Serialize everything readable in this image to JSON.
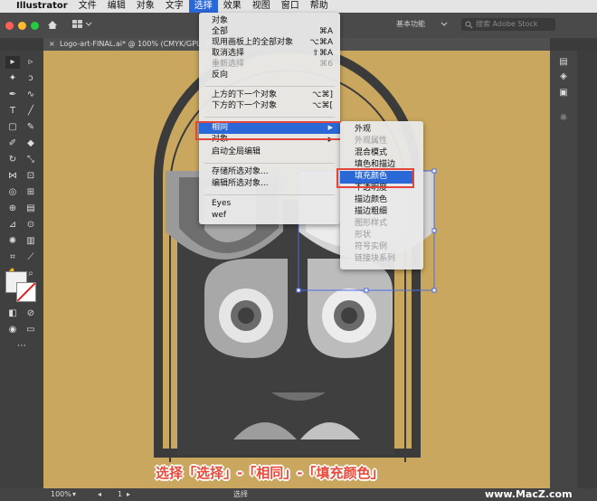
{
  "menubar": {
    "apple": "",
    "app_name": "Illustrator",
    "items": [
      "文件",
      "编辑",
      "对象",
      "文字",
      "选择",
      "效果",
      "视图",
      "窗口",
      "帮助"
    ]
  },
  "appbar": {
    "workspace": "基本功能",
    "search_placeholder": "搜索 Adobe Stock"
  },
  "document_tab": "Logo-art-FINAL.ai* @ 100% (CMYK/GPU 预览)",
  "select_menu": {
    "items": [
      {
        "label": "对象",
        "shortcut": "",
        "disabled": false
      },
      {
        "label": "全部",
        "shortcut": "⌘A",
        "disabled": false
      },
      {
        "label": "现用画板上的全部对象",
        "shortcut": "⌥⌘A",
        "disabled": false
      },
      {
        "label": "取消选择",
        "shortcut": "⇧⌘A",
        "disabled": false
      },
      {
        "label": "重新选择",
        "shortcut": "⌘6",
        "disabled": true
      },
      {
        "label": "反向",
        "shortcut": "",
        "disabled": false
      },
      {
        "label": "上方的下一个对象",
        "shortcut": "⌥⌘]",
        "disabled": false
      },
      {
        "label": "下方的下一个对象",
        "shortcut": "⌥⌘[",
        "disabled": false
      },
      {
        "label": "相同",
        "shortcut": "▶",
        "disabled": false
      },
      {
        "label": "对象",
        "shortcut": "▶",
        "disabled": false
      },
      {
        "label": "启动全局编辑",
        "shortcut": "",
        "disabled": false
      },
      {
        "label": "存储所选对象...",
        "shortcut": "",
        "disabled": false
      },
      {
        "label": "编辑所选对象...",
        "shortcut": "",
        "disabled": false
      },
      {
        "label": "Eyes",
        "shortcut": "",
        "disabled": false
      },
      {
        "label": "wef",
        "shortcut": "",
        "disabled": false
      }
    ]
  },
  "same_submenu": {
    "items": [
      {
        "label": "外观",
        "disabled": false
      },
      {
        "label": "外观属性",
        "disabled": true
      },
      {
        "label": "混合模式",
        "disabled": false
      },
      {
        "label": "填色和描边",
        "disabled": false
      },
      {
        "label": "填充颜色",
        "disabled": false
      },
      {
        "label": "不透明度",
        "disabled": false
      },
      {
        "label": "描边颜色",
        "disabled": false
      },
      {
        "label": "描边粗细",
        "disabled": false
      },
      {
        "label": "图形样式",
        "disabled": true
      },
      {
        "label": "形状",
        "disabled": true
      },
      {
        "label": "符号实例",
        "disabled": true
      },
      {
        "label": "链接块系列",
        "disabled": true
      }
    ]
  },
  "status": {
    "zoom": "100%",
    "artboard": "1",
    "tool": "选择"
  },
  "caption": "选择「选择」-「相同」-「填充颜色」",
  "watermark": "www.MacZ.com",
  "colors": {
    "canvas": "#c9a75e",
    "menu_highlight": "#2a68d8",
    "callout_red": "#e2453c"
  }
}
